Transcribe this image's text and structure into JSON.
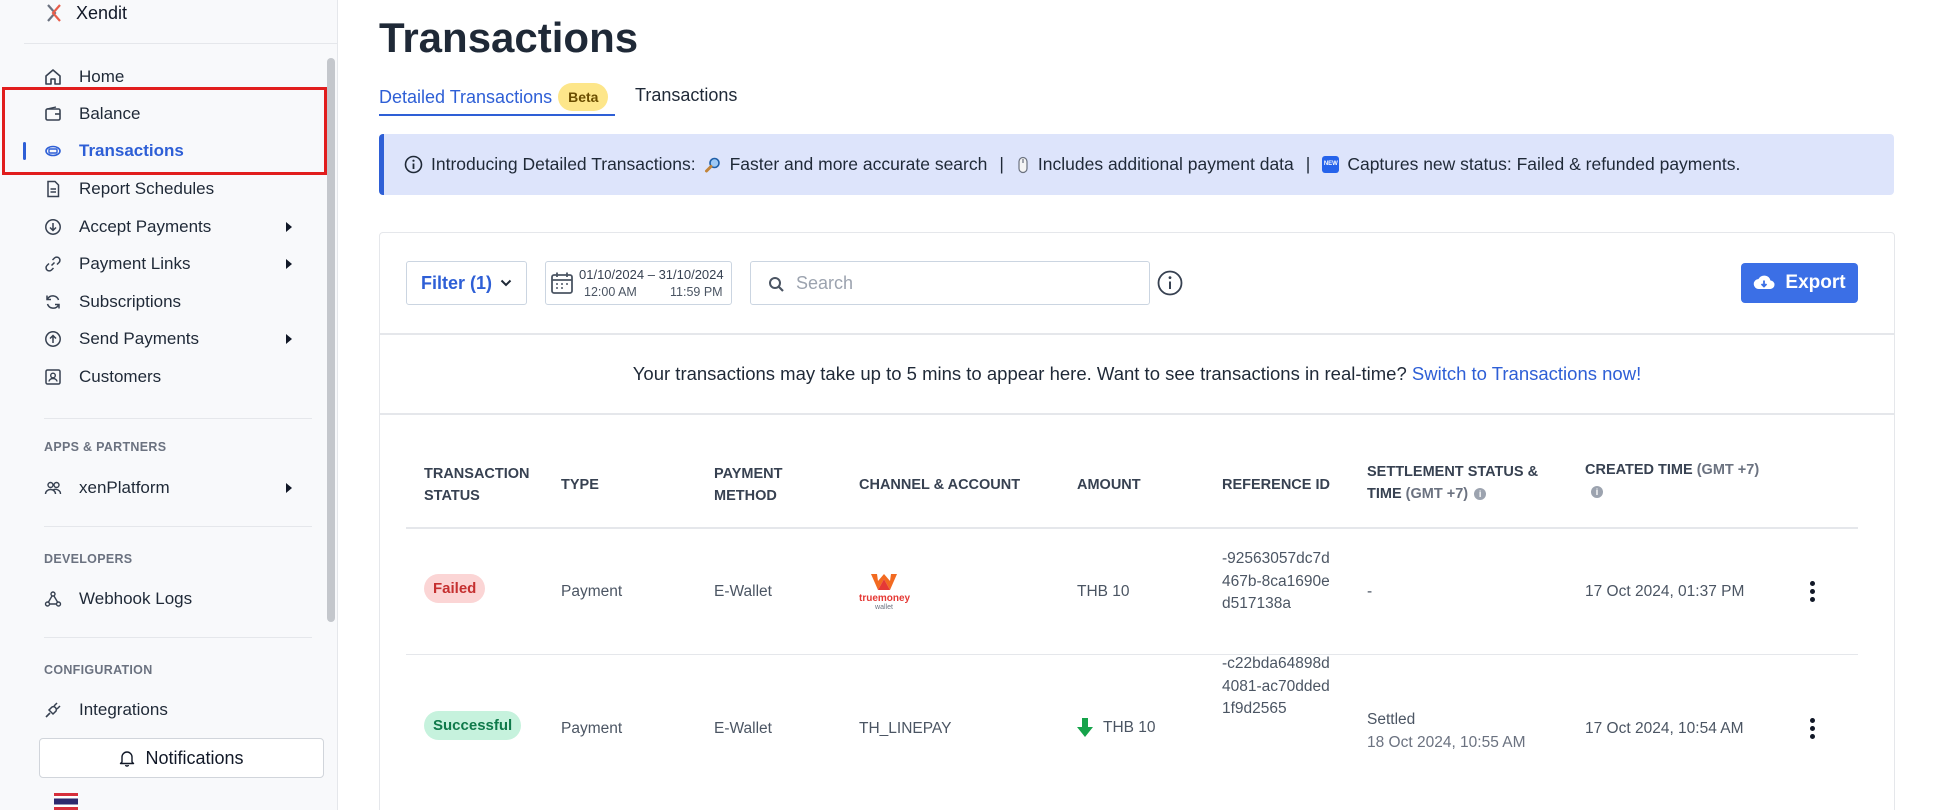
{
  "sidebar": {
    "brand": "Xendit",
    "items": [
      {
        "label": "Home",
        "icon": "home-icon"
      },
      {
        "label": "Balance",
        "icon": "wallet-icon"
      },
      {
        "label": "Transactions",
        "icon": "transactions-icon",
        "active": true
      },
      {
        "label": "Report Schedules",
        "icon": "document-icon"
      },
      {
        "label": "Accept Payments",
        "icon": "arrow-down-circle-icon",
        "expandable": true
      },
      {
        "label": "Payment Links",
        "icon": "link-icon",
        "expandable": true
      },
      {
        "label": "Subscriptions",
        "icon": "refresh-icon"
      },
      {
        "label": "Send Payments",
        "icon": "arrow-up-circle-icon",
        "expandable": true
      },
      {
        "label": "Customers",
        "icon": "id-card-icon"
      }
    ],
    "sections": {
      "apps": {
        "title": "APPS & PARTNERS",
        "items": [
          {
            "label": "xenPlatform",
            "icon": "users-icon",
            "expandable": true
          }
        ]
      },
      "developers": {
        "title": "DEVELOPERS",
        "items": [
          {
            "label": "Webhook Logs",
            "icon": "webhook-icon"
          }
        ]
      },
      "configuration": {
        "title": "CONFIGURATION",
        "items": [
          {
            "label": "Integrations",
            "icon": "plug-icon"
          }
        ]
      }
    },
    "notifications_label": "Notifications"
  },
  "main": {
    "title": "Transactions",
    "tabs": [
      {
        "label": "Detailed Transactions",
        "badge": "Beta",
        "active": true
      },
      {
        "label": "Transactions"
      }
    ],
    "banner": {
      "intro": "Introducing Detailed Transactions:",
      "point1": "Faster and more accurate search",
      "point2": "Includes additional payment data",
      "point3": "Captures new status: Failed & refunded payments.",
      "separator": "|",
      "new_badge": "NEW"
    },
    "toolbar": {
      "filter_label": "Filter (1)",
      "date_start": "01/10/2024",
      "date_end": "31/10/2024",
      "date_dash": "–",
      "time_start": "12:00 AM",
      "time_end": "11:59 PM",
      "search_placeholder": "Search",
      "export_label": "Export"
    },
    "notice": {
      "text": "Your transactions may take up to 5 mins to appear here. Want to see transactions in real-time?",
      "link": "Switch to Transactions now!"
    },
    "table": {
      "headers": {
        "status_1": "TRANSACTION",
        "status_2": "STATUS",
        "type": "TYPE",
        "method_1": "PAYMENT",
        "method_2": "METHOD",
        "channel": "CHANNEL & ACCOUNT",
        "amount": "AMOUNT",
        "reference": "REFERENCE ID",
        "settlement_1": "SETTLEMENT STATUS &",
        "settlement_2": "TIME",
        "settlement_tz": "(GMT +7)",
        "created_1": "CREATED TIME",
        "created_tz": "(GMT +7)"
      },
      "rows": [
        {
          "status": "Failed",
          "type": "Payment",
          "method": "E-Wallet",
          "channel_logo": "truemoney wallet",
          "channel_logo_text": "truemoney",
          "channel_logo_sub": "wallet",
          "amount": "THB 10",
          "reference": "-92563057dc7d467b-8ca1690ed517138a",
          "settlement_status": "-",
          "settlement_time": "",
          "created": "17 Oct 2024, 01:37 PM"
        },
        {
          "status": "Successful",
          "type": "Payment",
          "method": "E-Wallet",
          "channel": "TH_LINEPAY",
          "amount": "THB 10",
          "amount_icon": "arrow-down-green-icon",
          "reference": "-c22bda64898d4081-ac70dded1f9d2565",
          "settlement_status": "Settled",
          "settlement_time": "18 Oct 2024, 10:55 AM",
          "created": "17 Oct 2024, 10:54 AM"
        }
      ]
    }
  },
  "colors": {
    "accent": "#2e5fd6",
    "export_button": "#3b6fe6",
    "banner_bg": "#dde4fb",
    "highlight_box": "#e11d1d",
    "failed": "#c53030",
    "success": "#0f7a4a"
  }
}
